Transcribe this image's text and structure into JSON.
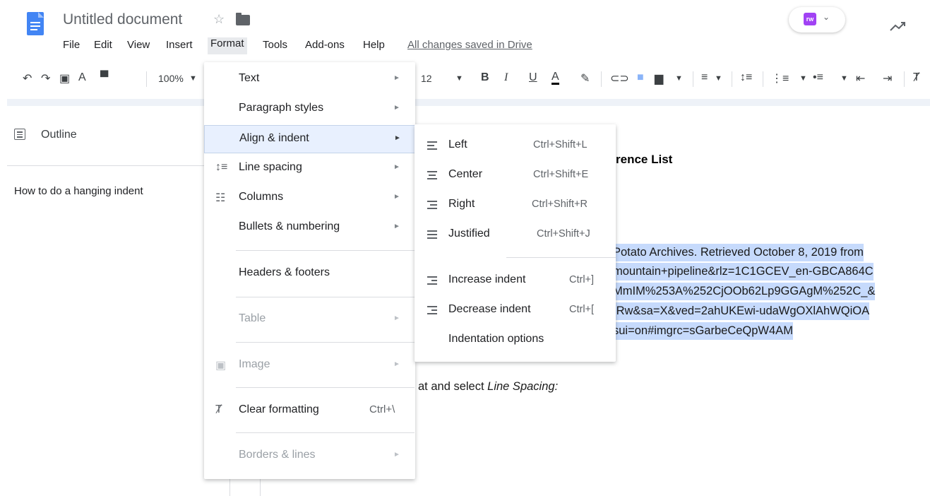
{
  "header": {
    "doc_title": "Untitled document",
    "star_glyph": "☆",
    "menus": [
      "File",
      "Edit",
      "View",
      "Insert",
      "Format",
      "Tools",
      "Add-ons",
      "Help"
    ],
    "saved_status": "All changes saved in Drive",
    "addon_logo_text": "rw",
    "addon_caret": "⌄"
  },
  "toolbar": {
    "zoom": "100%",
    "font_size": "12",
    "bold": "B",
    "italic": "I",
    "underline": "U",
    "text_color": "A"
  },
  "outline": {
    "label": "Outline",
    "heading": "How to do a hanging indent"
  },
  "document": {
    "heading_fragment": "rence List",
    "highlighted_lines": [
      "Potato Archives. Retrieved October 8, 2019 from",
      "mountain+pipeline&rlz=1C1GCEV_en-GBCA864C",
      "MmIM%253A%252CjOOb62Lp9GGAgM%252C_&",
      ":Rw&sa=X&ved=2ahUKEwi-udaWgOXlAhWQiOA",
      "sui=on#imgrc=sGarbeCeQpW4AM"
    ],
    "instruction_prefix": "at and select ",
    "instruction_italic": "Line Spacing:"
  },
  "format_menu": {
    "items": [
      {
        "label": "Text",
        "submenu": true,
        "disabled": false
      },
      {
        "label": "Paragraph styles",
        "submenu": true,
        "disabled": false
      },
      {
        "label": "Align & indent",
        "submenu": true,
        "disabled": false,
        "active": true
      },
      {
        "label": "Line spacing",
        "submenu": true,
        "disabled": false
      },
      {
        "label": "Columns",
        "submenu": true,
        "disabled": false
      },
      {
        "label": "Bullets & numbering",
        "submenu": true,
        "disabled": false
      },
      {
        "label": "Headers & footers",
        "submenu": false,
        "disabled": false
      },
      {
        "label": "Table",
        "submenu": true,
        "disabled": true
      },
      {
        "label": "Image",
        "submenu": true,
        "disabled": true
      },
      {
        "label": "Clear formatting",
        "shortcut": "Ctrl+\\",
        "disabled": false
      },
      {
        "label": "Borders & lines",
        "submenu": true,
        "disabled": true
      }
    ],
    "arrow_glyph": "►"
  },
  "align_menu": {
    "items": [
      {
        "label": "Left",
        "shortcut": "Ctrl+Shift+L"
      },
      {
        "label": "Center",
        "shortcut": "Ctrl+Shift+E"
      },
      {
        "label": "Right",
        "shortcut": "Ctrl+Shift+R"
      },
      {
        "label": "Justified",
        "shortcut": "Ctrl+Shift+J"
      },
      {
        "label": "Increase indent",
        "shortcut": "Ctrl+]"
      },
      {
        "label": "Decrease indent",
        "shortcut": "Ctrl+["
      },
      {
        "label": "Indentation options"
      }
    ]
  },
  "colors": {
    "active_menu_bg": "#e8f0fe",
    "selection_highlight": "#c6dafc",
    "brand_blue": "#4285f4"
  }
}
